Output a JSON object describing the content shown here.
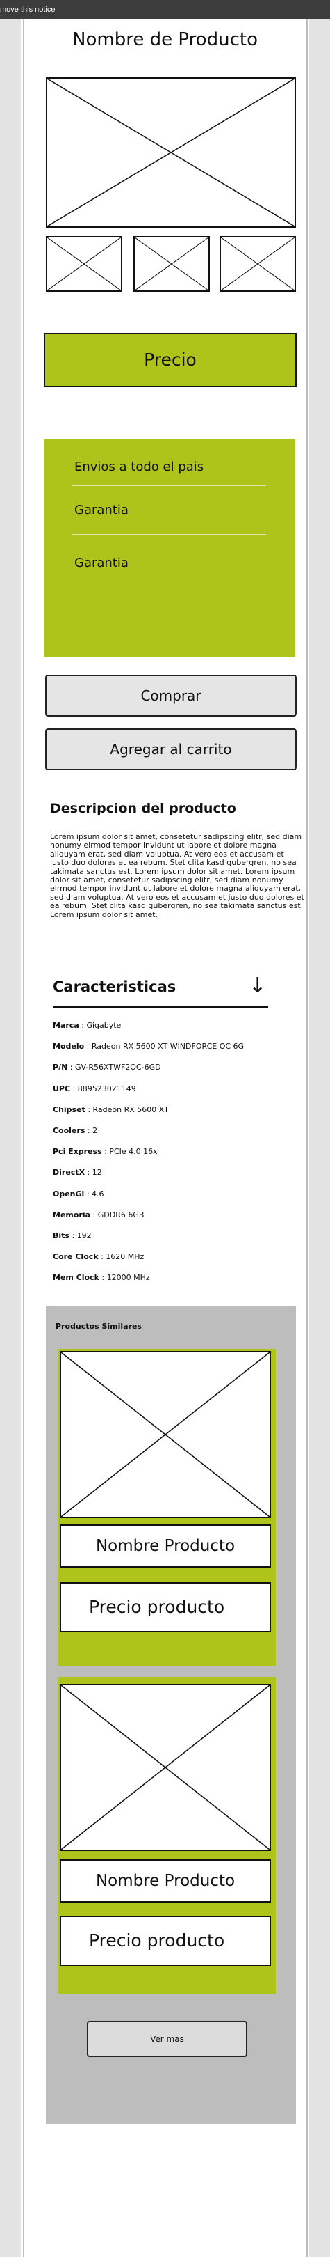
{
  "notice": {
    "text": "move this notice"
  },
  "product": {
    "title": "Nombre de Producto"
  },
  "price": {
    "label": "Precio"
  },
  "info": {
    "items": [
      "Envios a todo el pais",
      "Garantia",
      "Garantia"
    ]
  },
  "actions": {
    "buy": "Comprar",
    "add_cart": "Agregar al carrito"
  },
  "description": {
    "title": "Descripcion del producto",
    "text": "Lorem ipsum dolor sit amet, consetetur sadipscing elitr, sed diam nonumy eirmod tempor invidunt ut labore et dolore magna aliquyam erat, sed diam voluptua. At vero eos et accusam et justo duo dolores et ea rebum. Stet clita kasd gubergren, no sea takimata sanctus est. Lorem ipsum dolor sit amet. Lorem ipsum dolor sit amet, consetetur sadipscing elitr, sed diam nonumy eirmod tempor invidunt ut labore et dolore magna aliquyam erat, sed diam voluptua. At vero eos et accusam et justo duo dolores et ea rebum. Stet clita kasd gubergren, no sea takimata sanctus est. Lorem ipsum dolor sit amet."
  },
  "specs": {
    "title": "Caracteristicas",
    "arrow": "↓",
    "rows": [
      {
        "label": "Marca",
        "value": "Gigabyte"
      },
      {
        "label": "Modelo",
        "value": "Radeon RX 5600 XT WINDFORCE OC 6G"
      },
      {
        "label": "P/N",
        "value": "GV-R56XTWF2OC-6GD"
      },
      {
        "label": "UPC",
        "value": "889523021149"
      },
      {
        "label": "Chipset",
        "value": "Radeon RX 5600 XT"
      },
      {
        "label": "Coolers",
        "value": "2"
      },
      {
        "label": "Pci Express",
        "value": "PCIe 4.0 16x"
      },
      {
        "label": "DirectX",
        "value": "12"
      },
      {
        "label": "OpenGl",
        "value": "4.6"
      },
      {
        "label": "Memoria",
        "value": "GDDR6 6GB"
      },
      {
        "label": "Bits",
        "value": "192"
      },
      {
        "label": "Core Clock",
        "value": "1620 MHz"
      },
      {
        "label": "Mem Clock",
        "value": "12000 MHz"
      }
    ]
  },
  "similar": {
    "title": "Productos Similares",
    "cards": [
      {
        "name": "Nombre Producto",
        "price": "Precio producto"
      },
      {
        "name": "Nombre Producto",
        "price": "Precio producto"
      }
    ],
    "more": "Ver mas"
  },
  "colors": {
    "accent": "#aec41a",
    "panel": "#bdbdbd",
    "button": "#e5e5e5"
  }
}
